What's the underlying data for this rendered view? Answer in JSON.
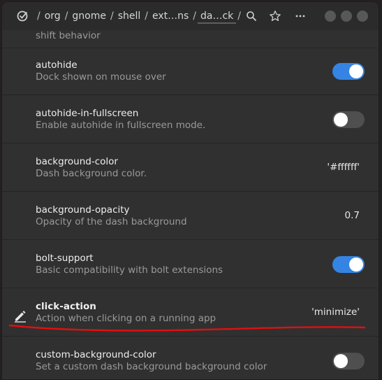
{
  "breadcrumbs": [
    "/",
    "org",
    "/",
    "gnome",
    "/",
    "shell",
    "/",
    "ext…ns",
    "/",
    "da…ck",
    "/"
  ],
  "headerbar": {
    "icons": [
      "settings-app-icon",
      "search-icon",
      "star-icon",
      "menu-dots-icon"
    ],
    "window_buttons": [
      "minimize",
      "maximize",
      "close"
    ]
  },
  "partial_row": {
    "desc": "shift behavior"
  },
  "rows": [
    {
      "name": "autohide",
      "desc": "Dock shown on mouse over",
      "control": "toggle",
      "state": true
    },
    {
      "name": "autohide-in-fullscreen",
      "desc": "Enable autohide in fullscreen mode.",
      "control": "toggle",
      "state": false
    },
    {
      "name": "background-color",
      "desc": "Dash background color.",
      "control": "value",
      "value": "'#ffffff'"
    },
    {
      "name": "background-opacity",
      "desc": "Opacity of the dash background",
      "control": "value",
      "value": "0.7"
    },
    {
      "name": "bolt-support",
      "desc": "Basic compatibility with bolt extensions",
      "control": "toggle",
      "state": true
    },
    {
      "name": "click-action",
      "desc": "Action when clicking on a running app",
      "control": "value",
      "value": "'minimize'",
      "modified": true
    },
    {
      "name": "custom-background-color",
      "desc": "Set a custom dash background background color",
      "control": "toggle",
      "state": false
    }
  ],
  "colors": {
    "accent": "#3584e4",
    "annotation": "#e01010"
  }
}
